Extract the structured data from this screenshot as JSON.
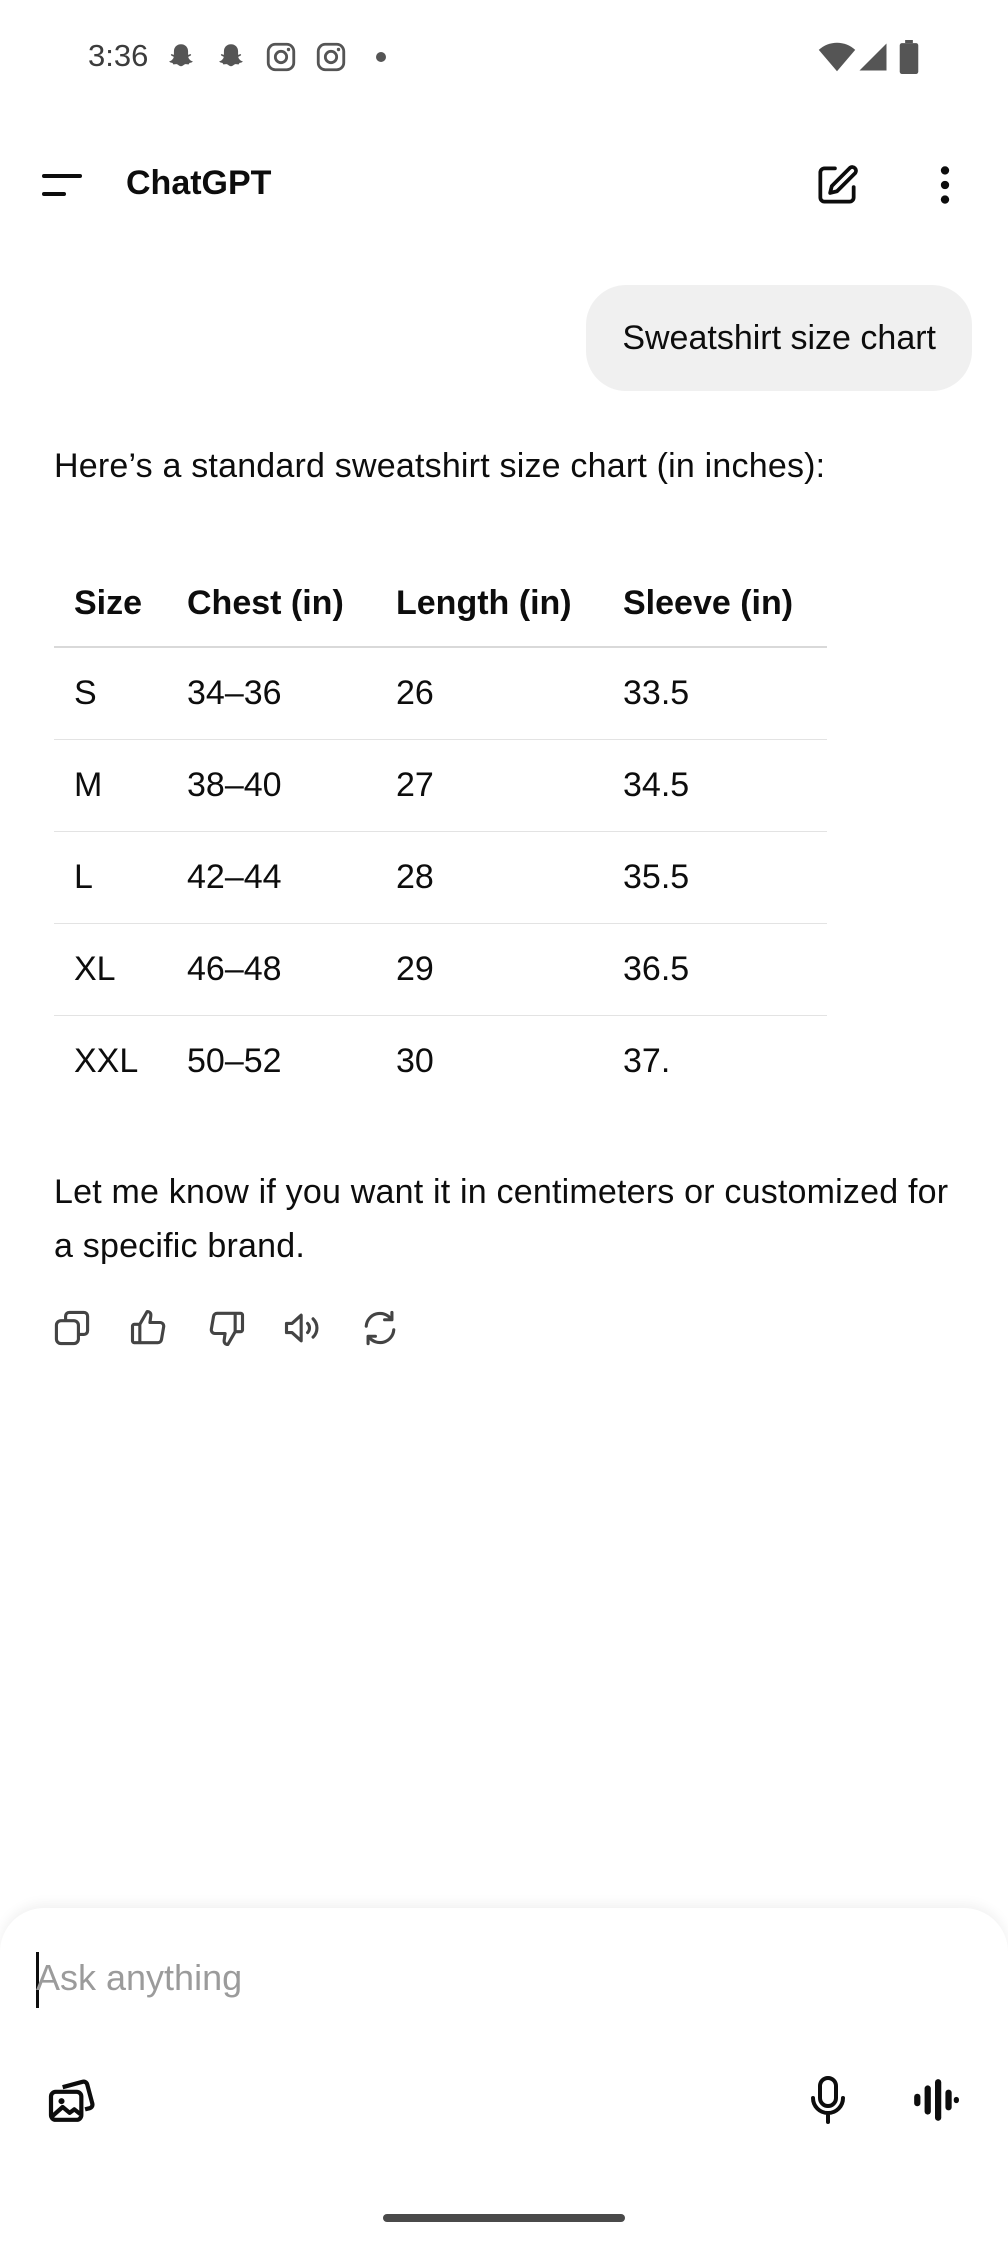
{
  "status_bar": {
    "time": "3:36",
    "left_icons": [
      "snapchat-icon",
      "snapchat-icon",
      "instagram-icon",
      "instagram-icon",
      "dot-icon"
    ],
    "right_icons": [
      "wifi-icon",
      "cellular-signal-icon",
      "battery-icon"
    ]
  },
  "header": {
    "title": "ChatGPT",
    "menu_icon": "menu-icon",
    "new_chat_icon": "edit-icon",
    "more_icon": "more-vertical-icon"
  },
  "conversation": {
    "user_message": "Sweatshirt size chart",
    "assistant_intro": "Here’s a standard sweatshirt size chart (in inches):",
    "table": {
      "headers": [
        "Size",
        "Chest (in)",
        "Length (in)",
        "Sleeve (in)"
      ],
      "rows": [
        [
          "S",
          "34–36",
          "26",
          "33.5"
        ],
        [
          "M",
          "38–40",
          "27",
          "34.5"
        ],
        [
          "L",
          "42–44",
          "28",
          "35.5"
        ],
        [
          "XL",
          "46–48",
          "29",
          "36.5"
        ],
        [
          "XXL",
          "50–52",
          "30",
          "37."
        ]
      ]
    },
    "assistant_outro": "Let me know if you want it in centimeters or customized for a specific brand.",
    "action_icons": [
      "copy-icon",
      "thumbs-up-icon",
      "thumbs-down-icon",
      "read-aloud-icon",
      "regenerate-icon"
    ]
  },
  "composer": {
    "placeholder": "Ask anything",
    "value": "",
    "icons": [
      "attach-image-icon",
      "microphone-icon",
      "voice-mode-icon"
    ]
  },
  "colors": {
    "bubble_bg": "#f0f0f0",
    "text": "#0d0d0d",
    "placeholder": "#9b9b9b",
    "divider": "#e3e3e3"
  }
}
